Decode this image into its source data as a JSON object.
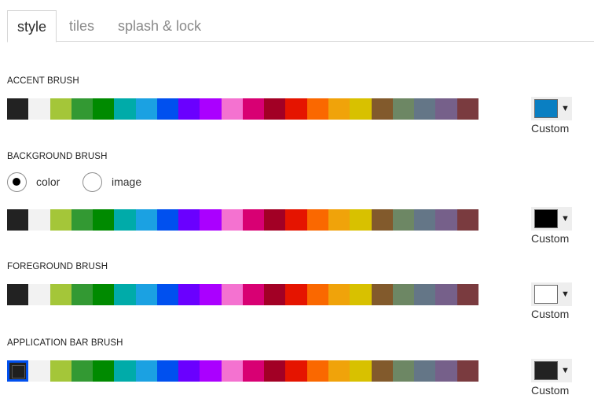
{
  "tabs": [
    {
      "label": "style",
      "active": true
    },
    {
      "label": "tiles",
      "active": false
    },
    {
      "label": "splash & lock",
      "active": false
    }
  ],
  "palette": [
    "#222222",
    "#f2f2f2",
    "#a4c639",
    "#339933",
    "#008a00",
    "#00aba9",
    "#1ba1e2",
    "#0050ef",
    "#6a00ff",
    "#aa00ff",
    "#f472d0",
    "#d80073",
    "#a20025",
    "#e51400",
    "#fa6800",
    "#f0a30a",
    "#d8c100",
    "#825a2c",
    "#6d8764",
    "#647687",
    "#76608a",
    "#7a3b3f"
  ],
  "sections": [
    {
      "title": "ACCENT BRUSH",
      "custom_color": "#0a7fc2",
      "custom_label": "Custom",
      "selected_index": -1
    },
    {
      "title": "BACKGROUND BRUSH",
      "custom_color": "#000000",
      "custom_label": "Custom",
      "selected_index": -1
    },
    {
      "title": "FOREGROUND BRUSH",
      "custom_color": "#ffffff",
      "custom_label": "Custom",
      "selected_index": -1
    },
    {
      "title": "APPLICATION BAR BRUSH",
      "custom_color": "#222222",
      "custom_label": "Custom",
      "selected_index": 0
    }
  ],
  "background_mode": {
    "options": [
      {
        "label": "color",
        "checked": true
      },
      {
        "label": "image",
        "checked": false
      }
    ]
  },
  "dropdown_icon": "triangle-down-icon"
}
